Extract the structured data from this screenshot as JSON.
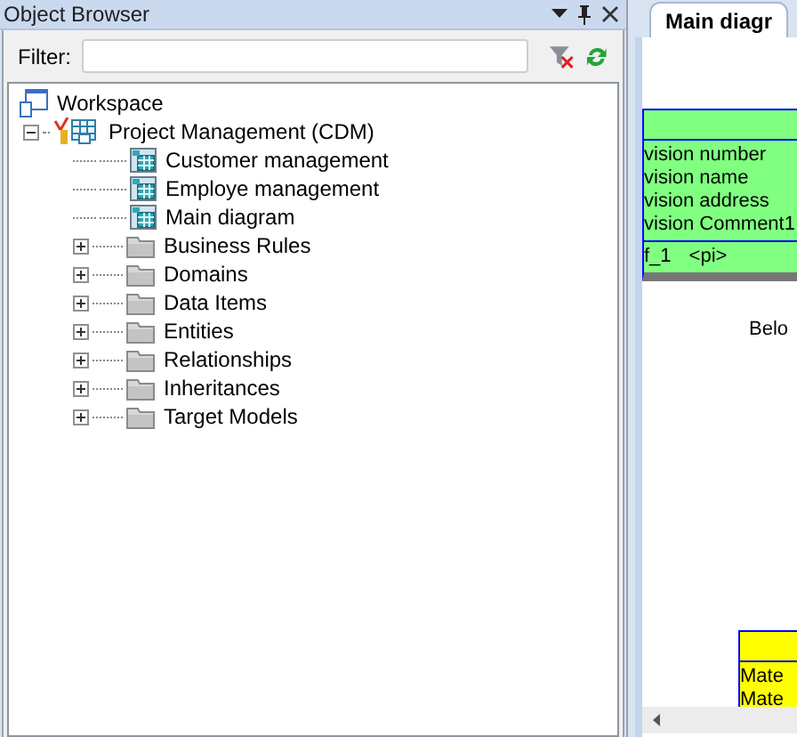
{
  "panel": {
    "title": "Object Browser"
  },
  "filter": {
    "label": "Filter:"
  },
  "tree": {
    "label": "Workspace",
    "kind": "workspace",
    "children": [
      {
        "label": "Project Management (CDM)",
        "kind": "model",
        "expanded": true,
        "children": [
          {
            "label": "Customer management",
            "kind": "diagram"
          },
          {
            "label": "Employe management",
            "kind": "diagram"
          },
          {
            "label": "Main diagram",
            "kind": "diagram"
          },
          {
            "label": "Business Rules",
            "kind": "folder",
            "expanded": false
          },
          {
            "label": "Domains",
            "kind": "folder",
            "expanded": false
          },
          {
            "label": "Data Items",
            "kind": "folder",
            "expanded": false
          },
          {
            "label": "Entities",
            "kind": "folder",
            "expanded": false
          },
          {
            "label": "Relationships",
            "kind": "folder",
            "expanded": false
          },
          {
            "label": "Inheritances",
            "kind": "folder",
            "expanded": false
          },
          {
            "label": "Target Models",
            "kind": "folder",
            "expanded": false
          }
        ]
      }
    ]
  },
  "document_tab": {
    "label": "Main diagr",
    "selected": true
  },
  "diagram": {
    "entities": [
      {
        "color": "#80ff80",
        "attributes": [
          "vision number",
          "vision name",
          "vision address",
          "vision Comment1"
        ],
        "identifiers": [
          {
            "name": "f_1",
            "marker": "<pi>"
          }
        ]
      },
      {
        "color": "#ffff00",
        "attributes": [
          "Mate",
          "Mate"
        ]
      }
    ],
    "labels": [
      "Belo"
    ]
  }
}
